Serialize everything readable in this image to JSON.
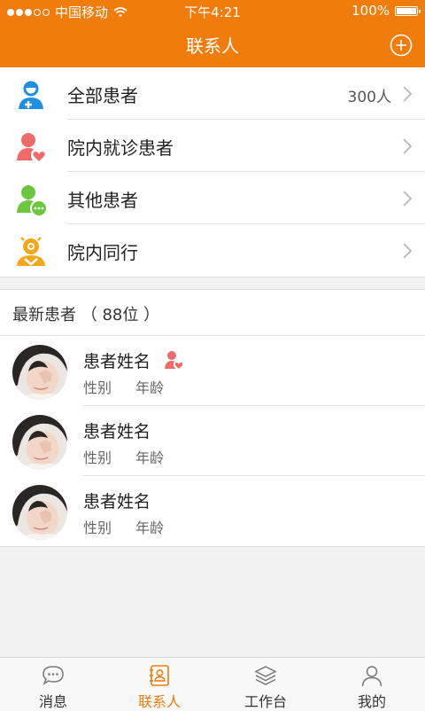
{
  "status_bar": {
    "carrier": "中国移动",
    "time": "下午4:21",
    "battery": "100%"
  },
  "header": {
    "title": "联系人"
  },
  "groups": [
    {
      "label": "全部患者",
      "count": "300人",
      "icon": "doctor-icon"
    },
    {
      "label": "院内就诊患者",
      "count": "",
      "icon": "patient-heart-icon"
    },
    {
      "label": "其他患者",
      "count": "",
      "icon": "patient-more-icon"
    },
    {
      "label": "院内同行",
      "count": "",
      "icon": "colleague-icon"
    }
  ],
  "latest": {
    "title": "最新患者 （ 88位 ）",
    "patients": [
      {
        "name": "患者姓名",
        "gender": "性别",
        "age": "年龄",
        "badge": true
      },
      {
        "name": "患者姓名",
        "gender": "性别",
        "age": "年龄",
        "badge": false
      },
      {
        "name": "患者姓名",
        "gender": "性别",
        "age": "年龄",
        "badge": false
      }
    ]
  },
  "tabbar": {
    "tabs": [
      {
        "label": "消息",
        "icon": "chat-bubble-icon",
        "active": false
      },
      {
        "label": "联系人",
        "icon": "contacts-icon",
        "active": true
      },
      {
        "label": "工作台",
        "icon": "layers-icon",
        "active": false
      },
      {
        "label": "我的",
        "icon": "user-icon",
        "active": false
      }
    ]
  },
  "colors": {
    "accent": "#f07c0c",
    "doctor": "#1f8fe0",
    "patient": "#f06a6a",
    "other": "#6cc63e",
    "colleague": "#f2a81d"
  }
}
